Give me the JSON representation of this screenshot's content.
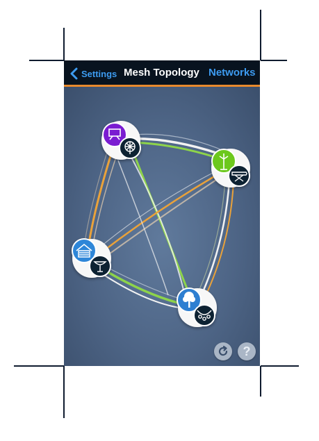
{
  "navbar": {
    "back_label": "Settings",
    "title": "Mesh Topology",
    "right_label": "Networks"
  },
  "colors": {
    "accent": "#3d9bf0",
    "nav_underline": "#e88a2d",
    "link_green": "#8ed44a",
    "link_orange": "#eaa23a",
    "link_white": "#f2f2f2"
  },
  "nodes": [
    {
      "name": "node-top-left",
      "primary_icon": "projector-screen-icon",
      "primary_color": "#7a1fd1",
      "secondary_icon": "fan-icon"
    },
    {
      "name": "node-right",
      "primary_icon": "coat-rack-icon",
      "primary_color": "#6cc81e",
      "secondary_icon": "ironing-board-icon"
    },
    {
      "name": "node-left",
      "primary_icon": "garage-icon",
      "primary_color": "#2f86d8",
      "secondary_icon": "birdbath-icon"
    },
    {
      "name": "node-bottom",
      "primary_icon": "tree-icon",
      "primary_color": "#2f7fd1",
      "secondary_icon": "string-lights-icon"
    }
  ],
  "controls": {
    "refresh_icon": "refresh-icon",
    "help_label": "?"
  }
}
